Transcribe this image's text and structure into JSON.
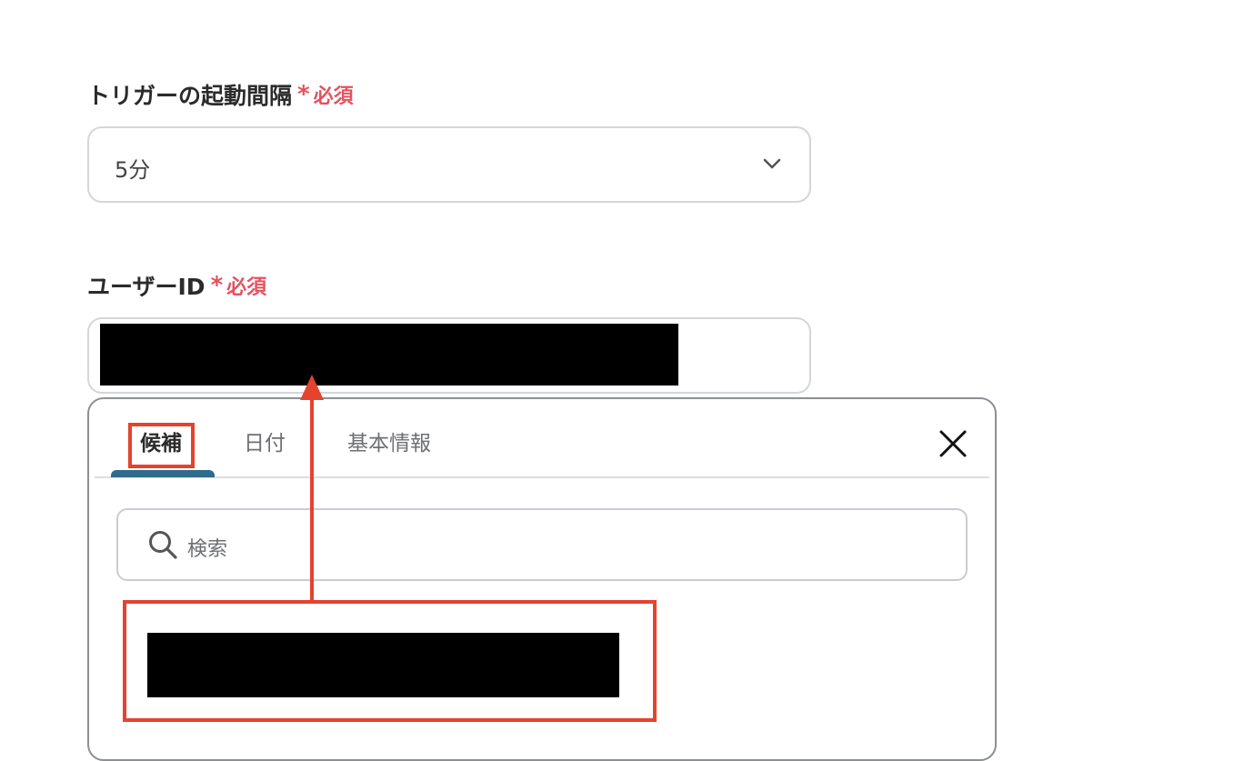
{
  "form": {
    "trigger_interval": {
      "label": "トリガーの起動間隔",
      "required_mark": "*",
      "required_text": "必須",
      "selected_value": "5分"
    },
    "user_id": {
      "label": "ユーザーID",
      "required_mark": "*",
      "required_text": "必須"
    }
  },
  "popup": {
    "tabs": [
      {
        "label": "候補",
        "active": true
      },
      {
        "label": "日付",
        "active": false
      },
      {
        "label": "基本情報",
        "active": false
      }
    ],
    "search": {
      "placeholder": "検索"
    }
  },
  "colors": {
    "required": "#e4525f",
    "highlight": "#e4432e",
    "tab_active_underline": "#2f6b8c"
  },
  "icons": {
    "select": "chevron-down-icon",
    "close": "close-icon",
    "search": "search-icon"
  }
}
